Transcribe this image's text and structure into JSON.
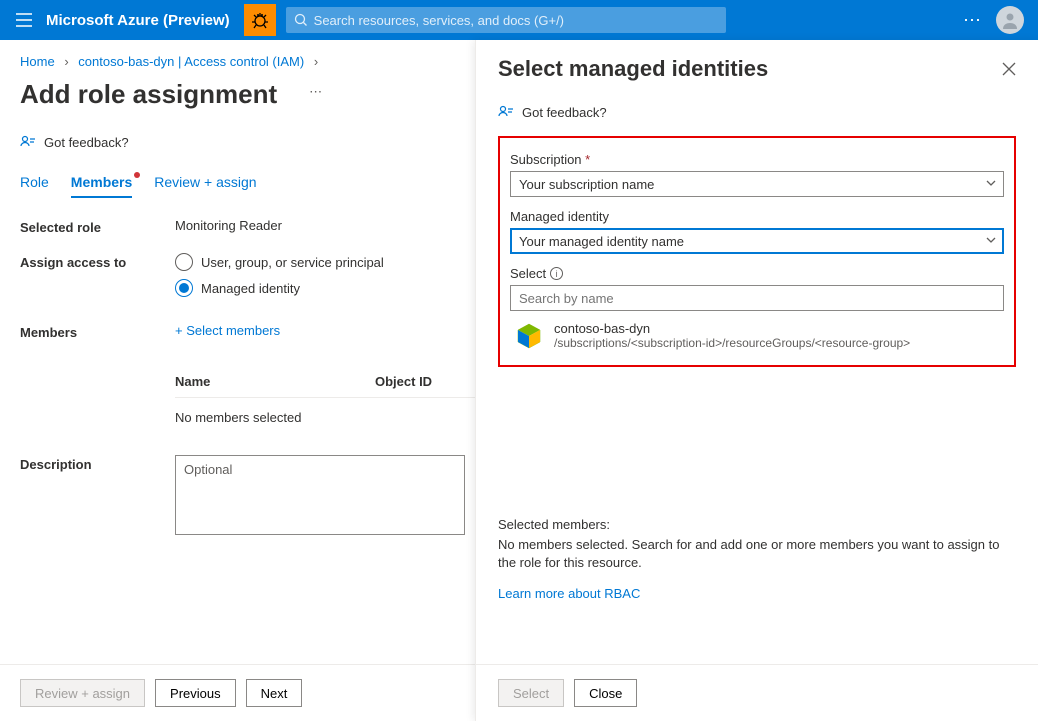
{
  "topbar": {
    "brand": "Microsoft Azure (Preview)",
    "search_placeholder": "Search resources, services, and docs (G+/)"
  },
  "breadcrumb": {
    "home": "Home",
    "path": "contoso-bas-dyn | Access control (IAM)"
  },
  "page": {
    "title": "Add role assignment",
    "feedback": "Got feedback?",
    "tabs": {
      "role": "Role",
      "members": "Members",
      "review": "Review + assign"
    },
    "labels": {
      "selected_role": "Selected role",
      "assign_access": "Assign access to",
      "members": "Members",
      "description": "Description"
    },
    "selected_role_value": "Monitoring Reader",
    "radio_user": "User, group, or service principal",
    "radio_mi": "Managed identity",
    "select_members": "Select members",
    "table": {
      "col_name": "Name",
      "col_objid": "Object ID",
      "empty": "No members selected"
    },
    "description_placeholder": "Optional",
    "footer": {
      "review": "Review + assign",
      "previous": "Previous",
      "next": "Next"
    }
  },
  "panel": {
    "title": "Select managed identities",
    "feedback": "Got feedback?",
    "labels": {
      "subscription": "Subscription",
      "mi": "Managed identity",
      "select": "Select"
    },
    "subscription_value": "Your subscription name",
    "mi_value": "Your managed identity name",
    "search_placeholder": "Search by name",
    "result": {
      "name": "contoso-bas-dyn",
      "path": "/subscriptions/<subscription-id>/resourceGroups/<resource-group>"
    },
    "selmem": {
      "title": "Selected members:",
      "text": "No members selected. Search for and add one or more members you want to assign to the role for this resource.",
      "link": "Learn more about RBAC"
    },
    "footer": {
      "select": "Select",
      "close": "Close"
    }
  }
}
